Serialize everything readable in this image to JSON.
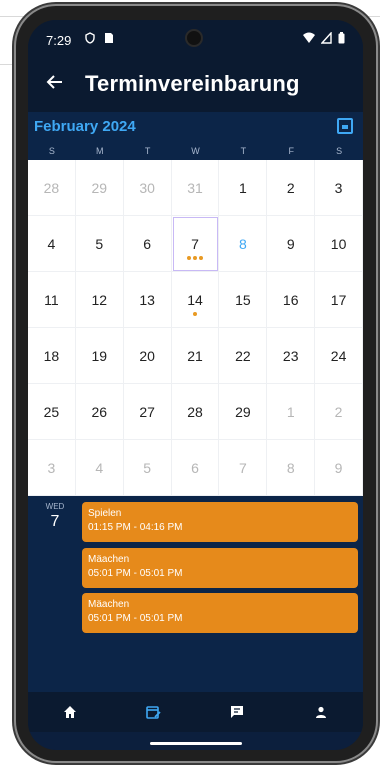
{
  "status_bar": {
    "time": "7:29"
  },
  "app_bar": {
    "title": "Terminvereinbarung"
  },
  "calendar": {
    "month_label": "February 2024",
    "weekdays": [
      "S",
      "M",
      "T",
      "W",
      "T",
      "F",
      "S"
    ],
    "days": [
      {
        "n": "28",
        "muted": true
      },
      {
        "n": "29",
        "muted": true
      },
      {
        "n": "30",
        "muted": true
      },
      {
        "n": "31",
        "muted": true
      },
      {
        "n": "1"
      },
      {
        "n": "2"
      },
      {
        "n": "3"
      },
      {
        "n": "4"
      },
      {
        "n": "5"
      },
      {
        "n": "6"
      },
      {
        "n": "7",
        "selected": true,
        "dots": 3
      },
      {
        "n": "8",
        "today": true
      },
      {
        "n": "9"
      },
      {
        "n": "10"
      },
      {
        "n": "11"
      },
      {
        "n": "12"
      },
      {
        "n": "13"
      },
      {
        "n": "14",
        "dots": 1
      },
      {
        "n": "15"
      },
      {
        "n": "16"
      },
      {
        "n": "17"
      },
      {
        "n": "18"
      },
      {
        "n": "19"
      },
      {
        "n": "20"
      },
      {
        "n": "21"
      },
      {
        "n": "22"
      },
      {
        "n": "23"
      },
      {
        "n": "24"
      },
      {
        "n": "25"
      },
      {
        "n": "26"
      },
      {
        "n": "27"
      },
      {
        "n": "28"
      },
      {
        "n": "29"
      },
      {
        "n": "1",
        "muted": true
      },
      {
        "n": "2",
        "muted": true
      },
      {
        "n": "3",
        "muted": true
      },
      {
        "n": "4",
        "muted": true
      },
      {
        "n": "5",
        "muted": true
      },
      {
        "n": "6",
        "muted": true
      },
      {
        "n": "7",
        "muted": true
      },
      {
        "n": "8",
        "muted": true
      },
      {
        "n": "9",
        "muted": true
      }
    ]
  },
  "events": {
    "weekday": "WED",
    "day": "7",
    "items": [
      {
        "title": "Spielen",
        "time": "01:15 PM - 04:16 PM"
      },
      {
        "title": "Mäachen",
        "time": "05:01 PM - 05:01 PM"
      },
      {
        "title": "Mäachen",
        "time": "05:01 PM - 05:01 PM"
      }
    ]
  },
  "colors": {
    "accent": "#3fa8f4",
    "event": "#e68a1b",
    "header_bg": "#0c2548",
    "appbar_bg": "#0b1a30"
  },
  "icons": {
    "back": "arrow-left-icon",
    "calendar": "calendar-today-icon",
    "home": "home-icon",
    "calendar_edit": "calendar-edit-icon",
    "chat": "chat-icon",
    "person": "person-icon"
  }
}
